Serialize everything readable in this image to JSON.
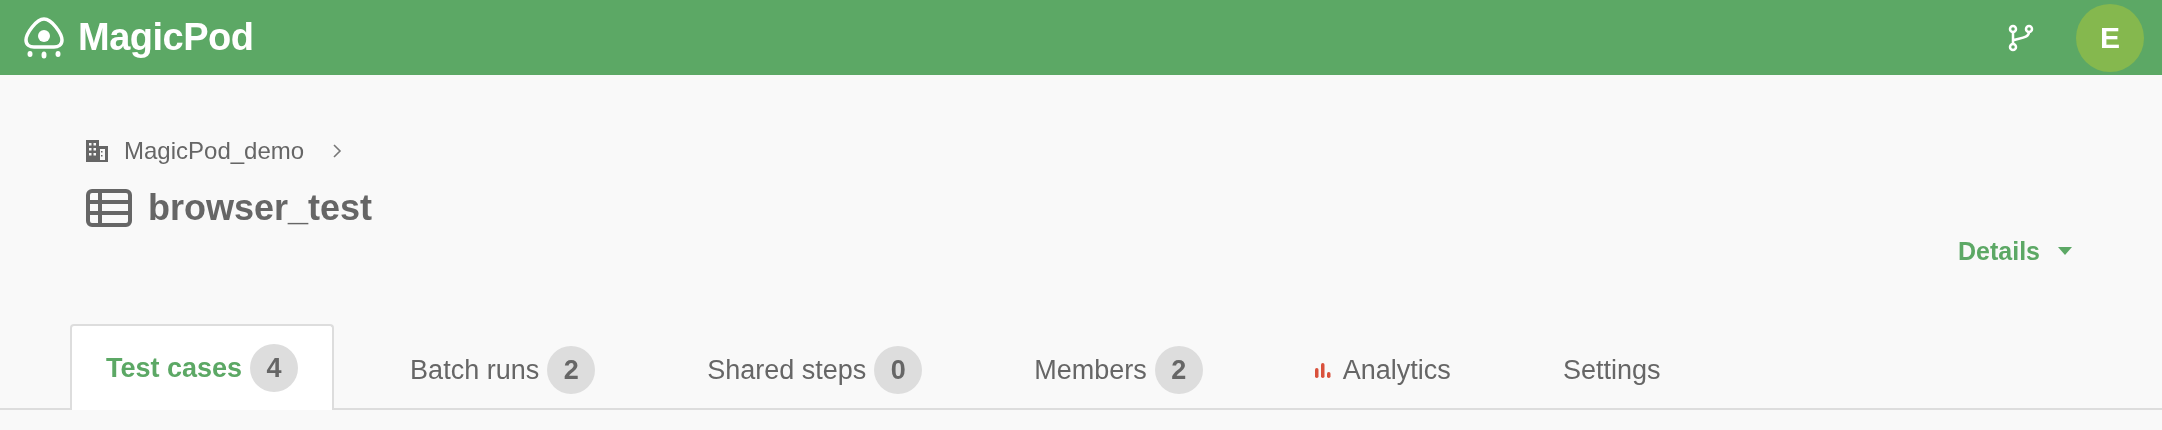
{
  "header": {
    "logo": "MagicPod",
    "avatar": "E"
  },
  "breadcrumb": {
    "organization": "MagicPod_demo"
  },
  "project": {
    "title": "browser_test"
  },
  "details_menu": {
    "label": "Details"
  },
  "tabs": [
    {
      "label": "Test cases",
      "count": "4",
      "selected": true,
      "kind": "count"
    },
    {
      "label": "Batch runs",
      "count": "2",
      "selected": false,
      "kind": "count"
    },
    {
      "label": "Shared steps",
      "count": "0",
      "selected": false,
      "kind": "count"
    },
    {
      "label": "Members",
      "count": "2",
      "selected": false,
      "kind": "count"
    },
    {
      "label": "Analytics",
      "selected": false,
      "kind": "icon"
    },
    {
      "label": "Settings",
      "selected": false,
      "kind": "plain"
    }
  ]
}
